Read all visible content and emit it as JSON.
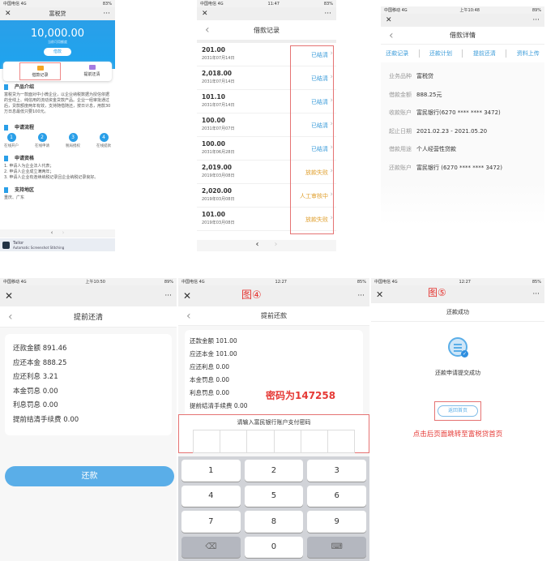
{
  "p1": {
    "status": "中国电信 4G",
    "battery": "83%",
    "title": "富税贷",
    "amount": "10,000.00",
    "amount_label": "当前可用额度",
    "borrow_btn": "借款",
    "tile1": "借款记录",
    "tile2": "提前还清",
    "intro_title": "产品介绍",
    "intro_text": "富税贷为一款面对中小微企业，以企业纳税数据为授信依据的全线上、纯信用的流动资金贷款产品。企业一经审批通过后，贷款额度两年有效，支持随借随还，按日计息，用款30万日息最低只要100元。",
    "flow_title": "申请流程",
    "steps": [
      {
        "n": "1",
        "label": "在线开户"
      },
      {
        "n": "2",
        "label": "在线申请"
      },
      {
        "n": "3",
        "label": "税局授权"
      },
      {
        "n": "4",
        "label": "在线提款"
      }
    ],
    "qual_title": "申请资格",
    "quals": [
      "1. 申请人为企业法人代表；",
      "2. 申请人企业成立满两年；",
      "3. 申请人企业有连续纳税记录且企业纳税记录良好。"
    ],
    "region_title": "支持地区",
    "regions": "重庆、广东",
    "app_name": "Tailor",
    "app_sub": "Automatic Screenshot Stitching"
  },
  "p2": {
    "status": "中国电信 4G",
    "time": "11:47",
    "battery": "83%",
    "title": "借款记录",
    "rows": [
      {
        "amount": "201.00",
        "date": "2031年07月14日",
        "status": "已结清",
        "color": "#3a9bd9"
      },
      {
        "amount": "2,018.00",
        "date": "2031年07月14日",
        "status": "已结清",
        "color": "#3a9bd9"
      },
      {
        "amount": "101.10",
        "date": "2031年07月14日",
        "status": "已结清",
        "color": "#3a9bd9"
      },
      {
        "amount": "100.00",
        "date": "2031年07月07日",
        "status": "已结清",
        "color": "#3a9bd9"
      },
      {
        "amount": "100.00",
        "date": "2031年06月28日",
        "status": "已结清",
        "color": "#3a9bd9"
      },
      {
        "amount": "2,019.00",
        "date": "2019年03月08日",
        "status": "放款失败",
        "color": "#e0a030"
      },
      {
        "amount": "2,020.00",
        "date": "2019年03月08日",
        "status": "人工审核中",
        "color": "#e0a030"
      },
      {
        "amount": "101.00",
        "date": "2019年03月08日",
        "status": "放款失败",
        "color": "#e0a030"
      }
    ]
  },
  "p3": {
    "status": "中国移动 4G",
    "time": "上午10:48",
    "battery": "89%",
    "title": "借款详情",
    "tabs": [
      "还款记录",
      "还款计划",
      "提前还清",
      "资料上传"
    ],
    "fields": [
      {
        "k": "业务品种",
        "v": "富税贷"
      },
      {
        "k": "借款金额",
        "v": "888.25元"
      },
      {
        "k": "收款账户",
        "v": "富民银行(6270 **** **** 3472)"
      },
      {
        "k": "起止日期",
        "v": "2021.02.23 - 2021.05.20"
      },
      {
        "k": "借款用途",
        "v": "个人经营性贷款"
      },
      {
        "k": "还款账户",
        "v": "富民银行 (6270 **** **** 3472)"
      }
    ]
  },
  "p4": {
    "status": "中国移动 4G",
    "time": "上午10:50",
    "battery": "89%",
    "title": "提前还清",
    "lines": [
      "还款金额 891.46",
      "应还本金 888.25",
      "应还利息 3.21",
      "本金罚息 0.00",
      "利息罚息 0.00",
      "提前结清手续费 0.00"
    ],
    "pay_btn": "还款"
  },
  "p5": {
    "status": "中国电信 4G",
    "time": "12:27",
    "battery": "85%",
    "fig": "图④",
    "title": "提前还款",
    "lines": [
      "还款金额 101.00",
      "应还本金 101.00",
      "应还利息 0.00",
      "本金罚息 0.00",
      "利息罚息 0.00",
      "提前结清手续费 0.00"
    ],
    "note": "密码为147258",
    "pwd_prompt": "请输入富民银行账户支付密码",
    "keys": [
      "1",
      "2",
      "3",
      "4",
      "5",
      "6",
      "7",
      "8",
      "9",
      "",
      "0",
      ""
    ]
  },
  "p6": {
    "status": "中国电信 4G",
    "time": "12:27",
    "battery": "85%",
    "fig": "图⑤",
    "title": "还款成功",
    "msg": "还款申请提交成功",
    "home_btn": "返回首页",
    "note": "点击后页面跳转至富税贷首页"
  },
  "colors": {
    "blue": "#2f9bea",
    "red": "#e53935"
  }
}
